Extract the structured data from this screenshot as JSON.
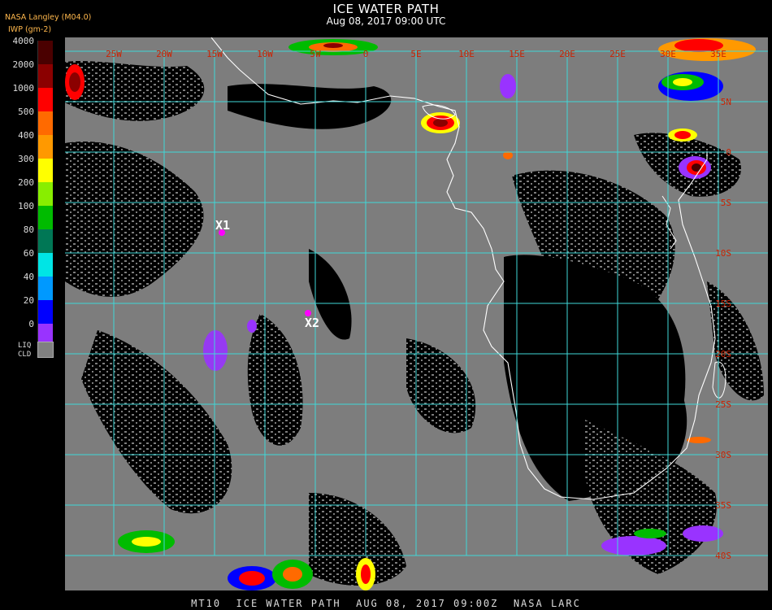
{
  "header": {
    "title": "ICE WATER PATH",
    "subtitle": "Aug 08, 2017 09:00 UTC",
    "org": "NASA Langley (M04.0)",
    "units": "IWP (gm-2)"
  },
  "legend": {
    "levels": [
      {
        "label": "4000",
        "color": "#4a0000"
      },
      {
        "label": "2000",
        "color": "#8b0000"
      },
      {
        "label": "1000",
        "color": "#ff0000"
      },
      {
        "label": "500",
        "color": "#ff6a00"
      },
      {
        "label": "400",
        "color": "#ff9900"
      },
      {
        "label": "300",
        "color": "#ffff00"
      },
      {
        "label": "200",
        "color": "#88ee00"
      },
      {
        "label": "100",
        "color": "#00bb00"
      },
      {
        "label": "80",
        "color": "#007755"
      },
      {
        "label": "60",
        "color": "#00e5e5"
      },
      {
        "label": "40",
        "color": "#0099ff"
      },
      {
        "label": "20",
        "color": "#0000ff"
      },
      {
        "label": "0",
        "color": "#9933ff"
      }
    ],
    "liquid_label_1": "LIQ",
    "liquid_label_2": "CLD",
    "liquid_color": "#808080"
  },
  "map": {
    "lon_labels": [
      "25W",
      "20W",
      "15W",
      "10W",
      "5W",
      "0",
      "5E",
      "10E",
      "15E",
      "20E",
      "25E",
      "30E",
      "35E"
    ],
    "lat_labels": [
      "5N",
      "0",
      "5S",
      "10S",
      "15S",
      "20S",
      "25S",
      "30S",
      "35S",
      "40S"
    ],
    "markers": [
      {
        "label": "X1",
        "color": "#ff00ff"
      },
      {
        "label": "X2",
        "color": "#ff00ff"
      }
    ],
    "grid_color": "#40d8d8",
    "coast_color": "#ffffff",
    "label_color": "#cc2200"
  },
  "footer": {
    "text": "MT10  ICE WATER PATH  AUG 08, 2017 09:00Z  NASA LARC"
  }
}
